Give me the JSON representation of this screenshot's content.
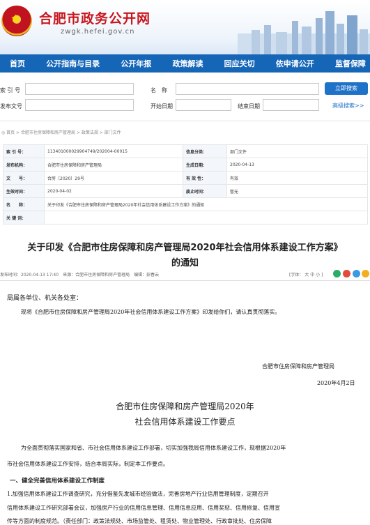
{
  "header": {
    "site_title": "合肥市政务公开网",
    "site_url": "zwgk.hefei.gov.cn",
    "colors": {
      "brand_red": "#c8161d",
      "nav_blue": "#1666b8",
      "link_blue": "#1e72c8"
    },
    "emblem_icon": "national-emblem-icon"
  },
  "nav": [
    "首页",
    "公开指南与目录",
    "公开年报",
    "政策解读",
    "回应关切",
    "依申请公开",
    "监督保障"
  ],
  "search": {
    "index_label": "索 引 号",
    "name_label": "名　称",
    "doc_no_label": "发布文号",
    "start_label": "开始日期",
    "end_label": "结束日期",
    "search_button": "立即搜索",
    "advanced_link": "高级搜索>>"
  },
  "breadcrumb": "◎ 首页 > 合肥市住房保障和房产管理局 > 政策法规 > 部门文件",
  "meta": {
    "rows": [
      {
        "k1": "索 引 号：",
        "v1": "11340100002990474​9/202004-00015",
        "k2": "信息分类：",
        "v2": "部门文件"
      },
      {
        "k1": "发布机构：",
        "v1": "合肥市住房保障和房产管理局",
        "k2": "生成日期：",
        "v2": "2020-04-13"
      },
      {
        "k1": "文　　号：",
        "v1": "合房〔2020〕29号",
        "k2": "有 效 性：",
        "v2": "有效"
      },
      {
        "k1": "生效时间：",
        "v1": "2020-04-02",
        "k2": "废止时间：",
        "v2": "暂无"
      }
    ],
    "name_label": "名　　称：",
    "name_value": "关于印发《合肥市住房保障和房产管理局2020年社会信用体系建设工作方案》的通知",
    "keywords_label": "关 键 词："
  },
  "article": {
    "title_line1": "关于印发《合肥市住房保障和房产管理局2020年社会信用体系建设工作方案》",
    "title_line2": "的通知",
    "info_left": "发布时间：2020-04-13 17:40　来源：合肥市住房保障和房产管理局　编辑：彭春云",
    "font_label": "[字体：",
    "font_large": "大",
    "font_medium": "中",
    "font_small": "小",
    "font_close": "]",
    "salutation": "局属各单位、机关各处室：",
    "para1": "现将《合肥市住房保障和房产管理局2020年社会信用体系建设工作方案》印发给你们，请认真贯彻落实。",
    "signature": "合肥市住房保障和房产管理局",
    "sign_date": "2020年4月2日",
    "subtitle1": "合肥市住房保障和房产管理局2020年",
    "subtitle2": "社会信用体系建设工作要点",
    "para2a": "为全面贯彻落实国家和省、市社会信用体系建设工作部署，切实加强我局信用体系建设工作，现根据2020年",
    "para2b": "市社会信用体系建设工作安排，结合本局实际，制定本工作要点。",
    "heading1": "一、健全完善信用体系建设工作制度",
    "para3a": "1.加强信用体系建设工作调查研究，充分借鉴先发城市经验做法，完善房地产行业信用管理制度，定期召开",
    "para3b": "信用体系建设工作研究部署会议，加强房产行业的信用信息管理、信用信息应用、信用奖惩、信用修复、信用宣",
    "para3c": "传等方面的制度规范。（责任部门：政策法规处、市场监管处、租赁处、物业管理处、行政审批处、住房保障"
  }
}
